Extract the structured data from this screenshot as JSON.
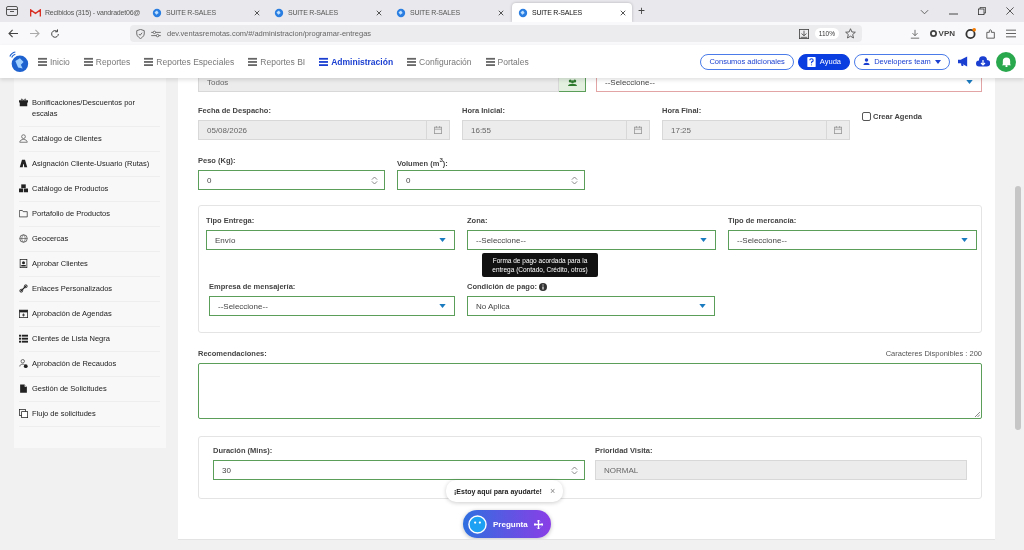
{
  "browser": {
    "tabs": [
      {
        "title": "Recibidos (315) - vandradet06@",
        "kind": "mail",
        "selected": false
      },
      {
        "title": "SUITE R-SALES",
        "kind": "app",
        "selected": false
      },
      {
        "title": "SUITE R-SALES",
        "kind": "app",
        "selected": false
      },
      {
        "title": "SUITE R-SALES",
        "kind": "app",
        "selected": false
      },
      {
        "title": "SUITE R-SALES",
        "kind": "app",
        "selected": true
      }
    ],
    "new_tab": "+",
    "url": "dev.ventasremotas.com/#/administracion/programar-entregas",
    "zoom": "110%",
    "vpn": "VPN"
  },
  "nav": {
    "items": [
      {
        "label": "Inicio",
        "selected": false
      },
      {
        "label": "Reportes",
        "selected": false
      },
      {
        "label": "Reportes Especiales",
        "selected": false
      },
      {
        "label": "Reportes BI",
        "selected": false
      },
      {
        "label": "Administración",
        "selected": true
      },
      {
        "label": "Configuración",
        "selected": false
      },
      {
        "label": "Portales",
        "selected": false
      }
    ],
    "extra_button": "Consumos adicionales",
    "help_button": "Ayuda",
    "user_menu": "Developers team"
  },
  "sidebar": {
    "items": [
      {
        "label": "Bonificaciones/Descuentos por escalas"
      },
      {
        "label": "Catálogo de Clientes"
      },
      {
        "label": "Asignación Cliente-Usuario (Rutas)"
      },
      {
        "label": "Catálogo de Productos"
      },
      {
        "label": "Portafolio de Productos"
      },
      {
        "label": "Geocercas"
      },
      {
        "label": "Aprobar Clientes"
      },
      {
        "label": "Enlaces Personalizados"
      },
      {
        "label": "Aprobación de Agendas"
      },
      {
        "label": "Clientes de Lista Negra"
      },
      {
        "label": "Aprobación de Recaudos"
      },
      {
        "label": "Gestión de Solicitudes"
      },
      {
        "label": "Flujo de solicitudes"
      }
    ]
  },
  "form": {
    "client_field": {
      "value": "Todos",
      "disabled": true
    },
    "route_select": {
      "value": "--Seleccione--",
      "kind": "select",
      "disabled": false,
      "invalid": true
    },
    "schedule": [
      {
        "label": "Fecha de Despacho:",
        "value": "05/08/2026",
        "kind": "date",
        "disabled": true
      },
      {
        "label": "Hora Inicial:",
        "value": "16:55",
        "kind": "date",
        "disabled": true
      },
      {
        "label": "Hora Final:",
        "value": "17:25",
        "kind": "date",
        "disabled": true
      }
    ],
    "crear_agenda": {
      "label": "Crear Agenda",
      "checked": false
    },
    "measures": [
      {
        "label": "Peso (Kg):",
        "value": "0",
        "kind": "number",
        "disabled": false
      },
      {
        "label": "Volumen (m$^{3}$):",
        "value": "0",
        "kind": "number",
        "disabled": false
      }
    ],
    "delivery": [
      [
        {
          "label": "Tipo Entrega:",
          "value": "Envío",
          "kind": "select",
          "disabled": false
        },
        {
          "label": "Zona:",
          "value": "--Seleccione--",
          "kind": "select",
          "disabled": false
        },
        {
          "label": "Tipo de mercancía:",
          "value": "--Seleccione--",
          "kind": "select",
          "disabled": false
        }
      ],
      [
        {
          "label": "Empresa de mensajería:",
          "value": "--Seleccione--",
          "kind": "select",
          "disabled": false
        },
        {
          "label": "Condición de pago:",
          "value": "No Aplica",
          "kind": "select",
          "disabled": false,
          "tooltip": "Forma de pago acordada para la entrega (Contado, Crédito, otros)"
        }
      ]
    ],
    "recommendations": {
      "label": "Recomendaciones:",
      "counter": "Caracteres Disponibles : 200"
    },
    "visit": [
      {
        "label": "Duración (Mins):",
        "value": "30",
        "kind": "number",
        "disabled": false
      },
      {
        "label": "Prioridad Visita:",
        "value": "NORMAL",
        "kind": "text",
        "disabled": true
      }
    ]
  },
  "assistant": {
    "bubble": "¡Estoy aquí para ayudarte!",
    "close": "×",
    "button": "Pregunta"
  }
}
